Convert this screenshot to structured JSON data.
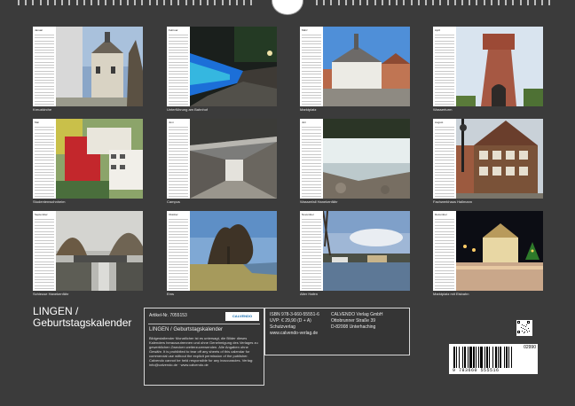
{
  "calendar": {
    "months": [
      {
        "name": "Januar",
        "caption": "Kreuzkirche"
      },
      {
        "name": "Februar",
        "caption": "Unterführung am Bahnhof"
      },
      {
        "name": "März",
        "caption": "Marktplatz"
      },
      {
        "name": "April",
        "caption": "Wasserturm"
      },
      {
        "name": "Mai",
        "caption": "Studentenwohnheim"
      },
      {
        "name": "Juni",
        "caption": "Campus"
      },
      {
        "name": "Juli",
        "caption": "Wasserfall Hanekenfähr"
      },
      {
        "name": "August",
        "caption": "Fachwerkhaus Hallmann"
      },
      {
        "name": "September",
        "caption": "Schleuse Hanekenfähr"
      },
      {
        "name": "Oktober",
        "caption": "Ems"
      },
      {
        "name": "November",
        "caption": "Alter Hafen"
      },
      {
        "name": "Dezember",
        "caption": "Marktplatz mit Eisbahn"
      }
    ]
  },
  "back": {
    "title_line1": "LINGEN /",
    "title_line2": "Geburtstagskalender",
    "info": {
      "article": "Artikel-Nr. 7055153",
      "logo": "CALVENDO",
      "title": "LINGEN / Geburtstagskalender",
      "description": "Bildgestaltender Monatlicher ist es untersagt, die Bilder dieses Kalenders herauszutrennen und ohne Genehmigung des Verlages zu gewerblichen Zwecken weiterzuverwenden. Alle Angaben ohne Gewähr. It is prohibited to tear off any sheets of this calendar for commercial use without the explicit permission of the publisher. Calvendo cannot be held responsible for any inaccuracies. Verlag: info@calvendo.de · www.calvendo.de"
    },
    "publisher": {
      "isbn": "ISBN 978-3-660-55551-6",
      "price": "UVP: € 29,90 (D + A)",
      "verlag_label": "Schutzverlag",
      "url": "www.calvendo-verlag.de",
      "company": "CALVENDO Verlag GmbH",
      "street": "Ottobrunner Straße 39",
      "city": "D-82008 Unterhaching"
    },
    "barcode": {
      "number": "9 783660 555516",
      "price_code": "02990"
    }
  },
  "colors": {
    "background": "#3b3b3b",
    "panel_border": "#d8d8d8",
    "text": "#ffffff"
  }
}
